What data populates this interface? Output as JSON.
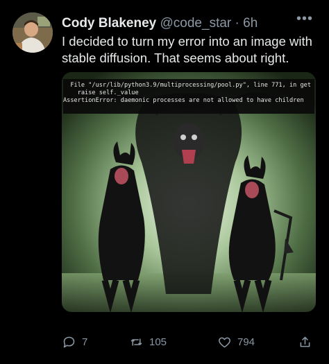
{
  "author": {
    "name": "Cody Blakeney",
    "handle": "@code_star",
    "separator": "·",
    "time": "6h"
  },
  "tweet": {
    "text": "I decided to turn my error into an image with stable diffusion. That seems about right."
  },
  "media": {
    "error_lines": [
      "  File \"/usr/lib/python3.9/multiprocessing/pool.py\", line 771, in get",
      "    raise self._value",
      "AssertionError: daemonic processes are not allowed to have children"
    ]
  },
  "actions": {
    "replies": "7",
    "retweets": "105",
    "likes": "794"
  },
  "icons": {
    "more": "more-icon",
    "reply": "reply-icon",
    "retweet": "retweet-icon",
    "like": "heart-icon",
    "share": "share-icon"
  },
  "colors": {
    "background": "#000000",
    "text": "#e7e9ea",
    "secondary": "#8b98a5"
  }
}
